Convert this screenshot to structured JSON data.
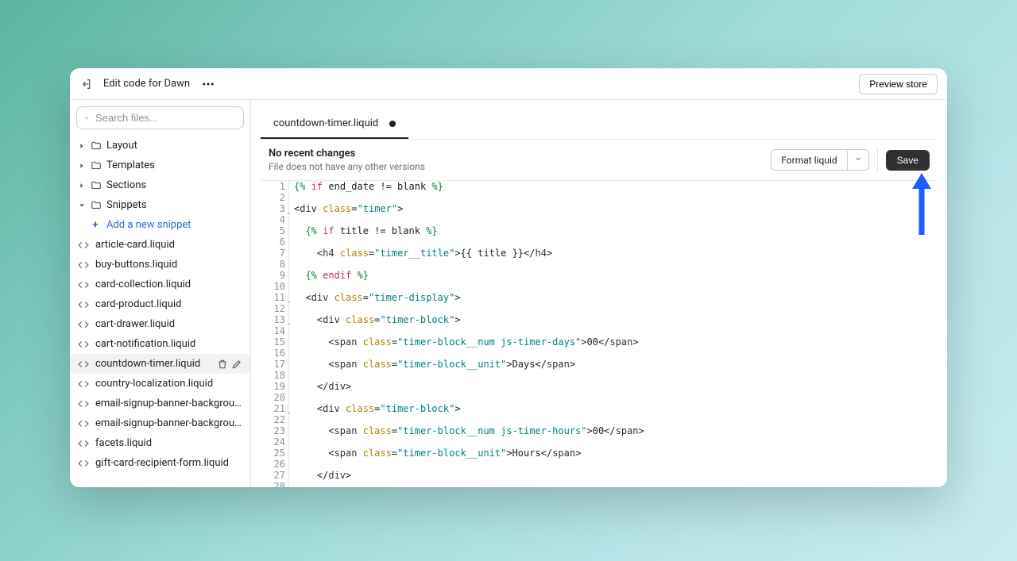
{
  "header": {
    "title": "Edit code for Dawn",
    "preview_label": "Preview store"
  },
  "search": {
    "placeholder": "Search files..."
  },
  "folders": [
    {
      "label": "Layout",
      "expanded": false
    },
    {
      "label": "Templates",
      "expanded": false
    },
    {
      "label": "Sections",
      "expanded": false
    },
    {
      "label": "Snippets",
      "expanded": true
    }
  ],
  "add_snippet_label": "Add a new snippet",
  "files": [
    {
      "label": "article-card.liquid"
    },
    {
      "label": "buy-buttons.liquid"
    },
    {
      "label": "card-collection.liquid"
    },
    {
      "label": "card-product.liquid"
    },
    {
      "label": "cart-drawer.liquid"
    },
    {
      "label": "cart-notification.liquid"
    },
    {
      "label": "countdown-timer.liquid",
      "active": true
    },
    {
      "label": "country-localization.liquid"
    },
    {
      "label": "email-signup-banner-background-..."
    },
    {
      "label": "email-signup-banner-background.li..."
    },
    {
      "label": "facets.liquid"
    },
    {
      "label": "gift-card-recipient-form.liquid"
    }
  ],
  "tab": {
    "label": "countdown-timer.liquid"
  },
  "subheader": {
    "title": "No recent changes",
    "desc": "File does not have any other versions",
    "format_label": "Format liquid",
    "save_label": "Save"
  },
  "code_lines": [
    {
      "n": 1,
      "html": "<span class='t-lq'>{%</span> <span class='t-kw'>if</span> end_date != blank <span class='t-lq'>%}</span>"
    },
    {
      "n": 2,
      "html": ""
    },
    {
      "n": 3,
      "fold": true,
      "html": "&lt;<span class='t-tag'>div</span> <span class='t-attr'>class</span>=<span class='t-str'>\"timer\"</span>&gt;"
    },
    {
      "n": 4,
      "html": ""
    },
    {
      "n": 5,
      "html": "  <span class='t-lq'>{%</span> <span class='t-kw'>if</span> title != blank <span class='t-lq'>%}</span>"
    },
    {
      "n": 6,
      "html": ""
    },
    {
      "n": 7,
      "html": "    &lt;<span class='t-tag'>h4</span> <span class='t-attr'>class</span>=<span class='t-str'>\"timer__title\"</span>&gt;{{ title }}&lt;/<span class='t-tag'>h4</span>&gt;"
    },
    {
      "n": 8,
      "html": ""
    },
    {
      "n": 9,
      "html": "  <span class='t-lq'>{%</span> <span class='t-kw'>endif</span> <span class='t-lq'>%}</span>"
    },
    {
      "n": 10,
      "html": ""
    },
    {
      "n": 11,
      "fold": true,
      "html": "  &lt;<span class='t-tag'>div</span> <span class='t-attr'>class</span>=<span class='t-str'>\"timer-display\"</span>&gt;"
    },
    {
      "n": 12,
      "html": ""
    },
    {
      "n": 13,
      "fold": true,
      "html": "    &lt;<span class='t-tag'>div</span> <span class='t-attr'>class</span>=<span class='t-str'>\"timer-block\"</span>&gt;"
    },
    {
      "n": 14,
      "html": ""
    },
    {
      "n": 15,
      "html": "      &lt;<span class='t-tag'>span</span> <span class='t-attr'>class</span>=<span class='t-str'>\"timer-block__num js-timer-days\"</span>&gt;00&lt;/<span class='t-tag'>span</span>&gt;"
    },
    {
      "n": 16,
      "html": ""
    },
    {
      "n": 17,
      "html": "      &lt;<span class='t-tag'>span</span> <span class='t-attr'>class</span>=<span class='t-str'>\"timer-block__unit\"</span>&gt;Days&lt;/<span class='t-tag'>span</span>&gt;"
    },
    {
      "n": 18,
      "html": ""
    },
    {
      "n": 19,
      "html": "    &lt;/<span class='t-tag'>div</span>&gt;"
    },
    {
      "n": 20,
      "html": ""
    },
    {
      "n": 21,
      "fold": true,
      "html": "    &lt;<span class='t-tag'>div</span> <span class='t-attr'>class</span>=<span class='t-str'>\"timer-block\"</span>&gt;"
    },
    {
      "n": 22,
      "html": ""
    },
    {
      "n": 23,
      "html": "      &lt;<span class='t-tag'>span</span> <span class='t-attr'>class</span>=<span class='t-str'>\"timer-block__num js-timer-hours\"</span>&gt;00&lt;/<span class='t-tag'>span</span>&gt;"
    },
    {
      "n": 24,
      "html": ""
    },
    {
      "n": 25,
      "html": "      &lt;<span class='t-tag'>span</span> <span class='t-attr'>class</span>=<span class='t-str'>\"timer-block__unit\"</span>&gt;Hours&lt;/<span class='t-tag'>span</span>&gt;"
    },
    {
      "n": 26,
      "html": ""
    },
    {
      "n": 27,
      "html": "    &lt;/<span class='t-tag'>div</span>&gt;"
    },
    {
      "n": 28,
      "html": ""
    }
  ]
}
